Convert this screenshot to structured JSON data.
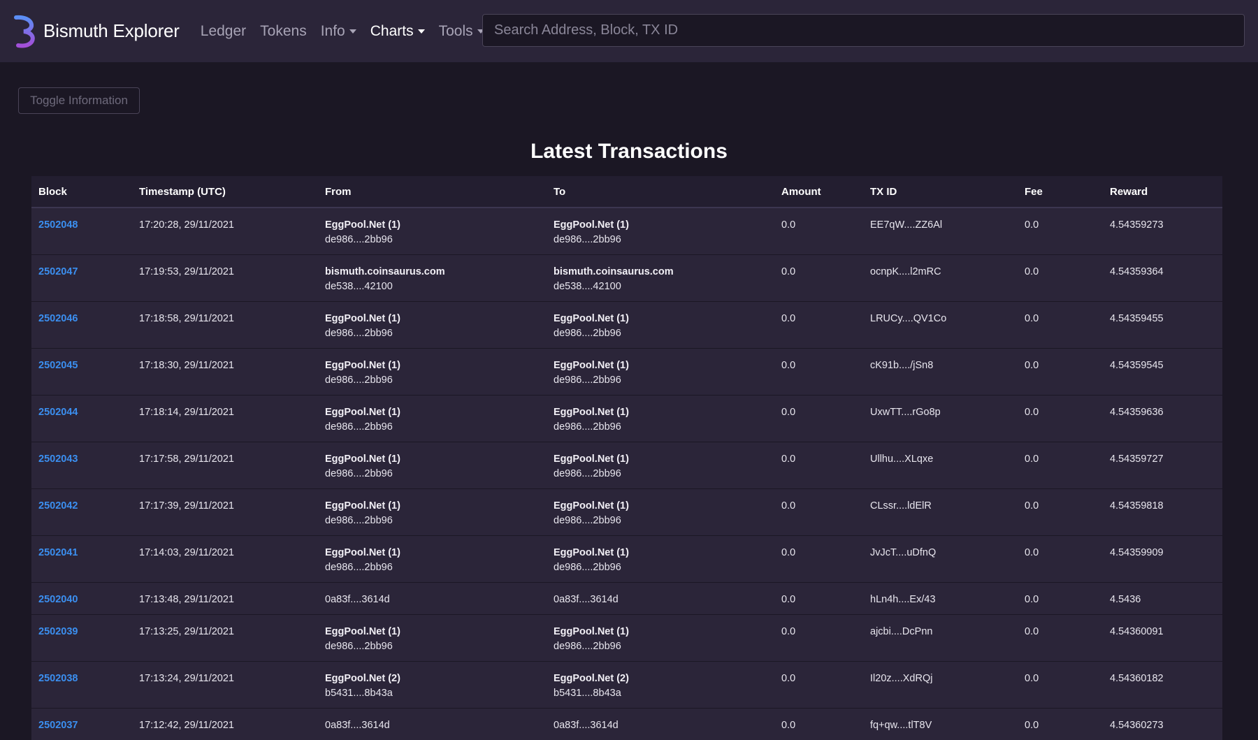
{
  "brand": {
    "name": "Bismuth Explorer",
    "accent": "#7a5cf0"
  },
  "nav": {
    "items": [
      {
        "label": "Ledger",
        "dropdown": false,
        "active": false
      },
      {
        "label": "Tokens",
        "dropdown": false,
        "active": false
      },
      {
        "label": "Info",
        "dropdown": true,
        "active": false
      },
      {
        "label": "Charts",
        "dropdown": true,
        "active": true
      },
      {
        "label": "Tools",
        "dropdown": true,
        "active": false
      }
    ]
  },
  "search": {
    "placeholder": "Search Address, Block, TX ID",
    "value": ""
  },
  "toggle_label": "Toggle Information",
  "page_title": "Latest Transactions",
  "table": {
    "headers": [
      "Block",
      "Timestamp (UTC)",
      "From",
      "To",
      "Amount",
      "TX ID",
      "Fee",
      "Reward"
    ],
    "rows": [
      {
        "block": "2502048",
        "timestamp": "17:20:28, 29/11/2021",
        "from_name": "EggPool.Net (1)",
        "from_addr": "de986....2bb96",
        "to_name": "EggPool.Net (1)",
        "to_addr": "de986....2bb96",
        "amount": "0.0",
        "txid": "EE7qW....ZZ6Al",
        "fee": "0.0",
        "reward": "4.54359273"
      },
      {
        "block": "2502047",
        "timestamp": "17:19:53, 29/11/2021",
        "from_name": "bismuth.coinsaurus.com",
        "from_addr": "de538....42100",
        "to_name": "bismuth.coinsaurus.com",
        "to_addr": "de538....42100",
        "amount": "0.0",
        "txid": "ocnpK....l2mRC",
        "fee": "0.0",
        "reward": "4.54359364"
      },
      {
        "block": "2502046",
        "timestamp": "17:18:58, 29/11/2021",
        "from_name": "EggPool.Net (1)",
        "from_addr": "de986....2bb96",
        "to_name": "EggPool.Net (1)",
        "to_addr": "de986....2bb96",
        "amount": "0.0",
        "txid": "LRUCy....QV1Co",
        "fee": "0.0",
        "reward": "4.54359455"
      },
      {
        "block": "2502045",
        "timestamp": "17:18:30, 29/11/2021",
        "from_name": "EggPool.Net (1)",
        "from_addr": "de986....2bb96",
        "to_name": "EggPool.Net (1)",
        "to_addr": "de986....2bb96",
        "amount": "0.0",
        "txid": "cK91b..../jSn8",
        "fee": "0.0",
        "reward": "4.54359545"
      },
      {
        "block": "2502044",
        "timestamp": "17:18:14, 29/11/2021",
        "from_name": "EggPool.Net (1)",
        "from_addr": "de986....2bb96",
        "to_name": "EggPool.Net (1)",
        "to_addr": "de986....2bb96",
        "amount": "0.0",
        "txid": "UxwTT....rGo8p",
        "fee": "0.0",
        "reward": "4.54359636"
      },
      {
        "block": "2502043",
        "timestamp": "17:17:58, 29/11/2021",
        "from_name": "EggPool.Net (1)",
        "from_addr": "de986....2bb96",
        "to_name": "EggPool.Net (1)",
        "to_addr": "de986....2bb96",
        "amount": "0.0",
        "txid": "Ullhu....XLqxe",
        "fee": "0.0",
        "reward": "4.54359727"
      },
      {
        "block": "2502042",
        "timestamp": "17:17:39, 29/11/2021",
        "from_name": "EggPool.Net (1)",
        "from_addr": "de986....2bb96",
        "to_name": "EggPool.Net (1)",
        "to_addr": "de986....2bb96",
        "amount": "0.0",
        "txid": "CLssr....ldElR",
        "fee": "0.0",
        "reward": "4.54359818"
      },
      {
        "block": "2502041",
        "timestamp": "17:14:03, 29/11/2021",
        "from_name": "EggPool.Net (1)",
        "from_addr": "de986....2bb96",
        "to_name": "EggPool.Net (1)",
        "to_addr": "de986....2bb96",
        "amount": "0.0",
        "txid": "JvJcT....uDfnQ",
        "fee": "0.0",
        "reward": "4.54359909"
      },
      {
        "block": "2502040",
        "timestamp": "17:13:48, 29/11/2021",
        "from_name": "",
        "from_addr": "0a83f....3614d",
        "to_name": "",
        "to_addr": "0a83f....3614d",
        "amount": "0.0",
        "txid": "hLn4h....Ex/43",
        "fee": "0.0",
        "reward": "4.5436"
      },
      {
        "block": "2502039",
        "timestamp": "17:13:25, 29/11/2021",
        "from_name": "EggPool.Net (1)",
        "from_addr": "de986....2bb96",
        "to_name": "EggPool.Net (1)",
        "to_addr": "de986....2bb96",
        "amount": "0.0",
        "txid": "ajcbi....DcPnn",
        "fee": "0.0",
        "reward": "4.54360091"
      },
      {
        "block": "2502038",
        "timestamp": "17:13:24, 29/11/2021",
        "from_name": "EggPool.Net (2)",
        "from_addr": "b5431....8b43a",
        "to_name": "EggPool.Net (2)",
        "to_addr": "b5431....8b43a",
        "amount": "0.0",
        "txid": "Il20z....XdRQj",
        "fee": "0.0",
        "reward": "4.54360182"
      },
      {
        "block": "2502037",
        "timestamp": "17:12:42, 29/11/2021",
        "from_name": "",
        "from_addr": "0a83f....3614d",
        "to_name": "",
        "to_addr": "0a83f....3614d",
        "amount": "0.0",
        "txid": "fq+qw....tlT8V",
        "fee": "0.0",
        "reward": "4.54360273"
      }
    ]
  }
}
